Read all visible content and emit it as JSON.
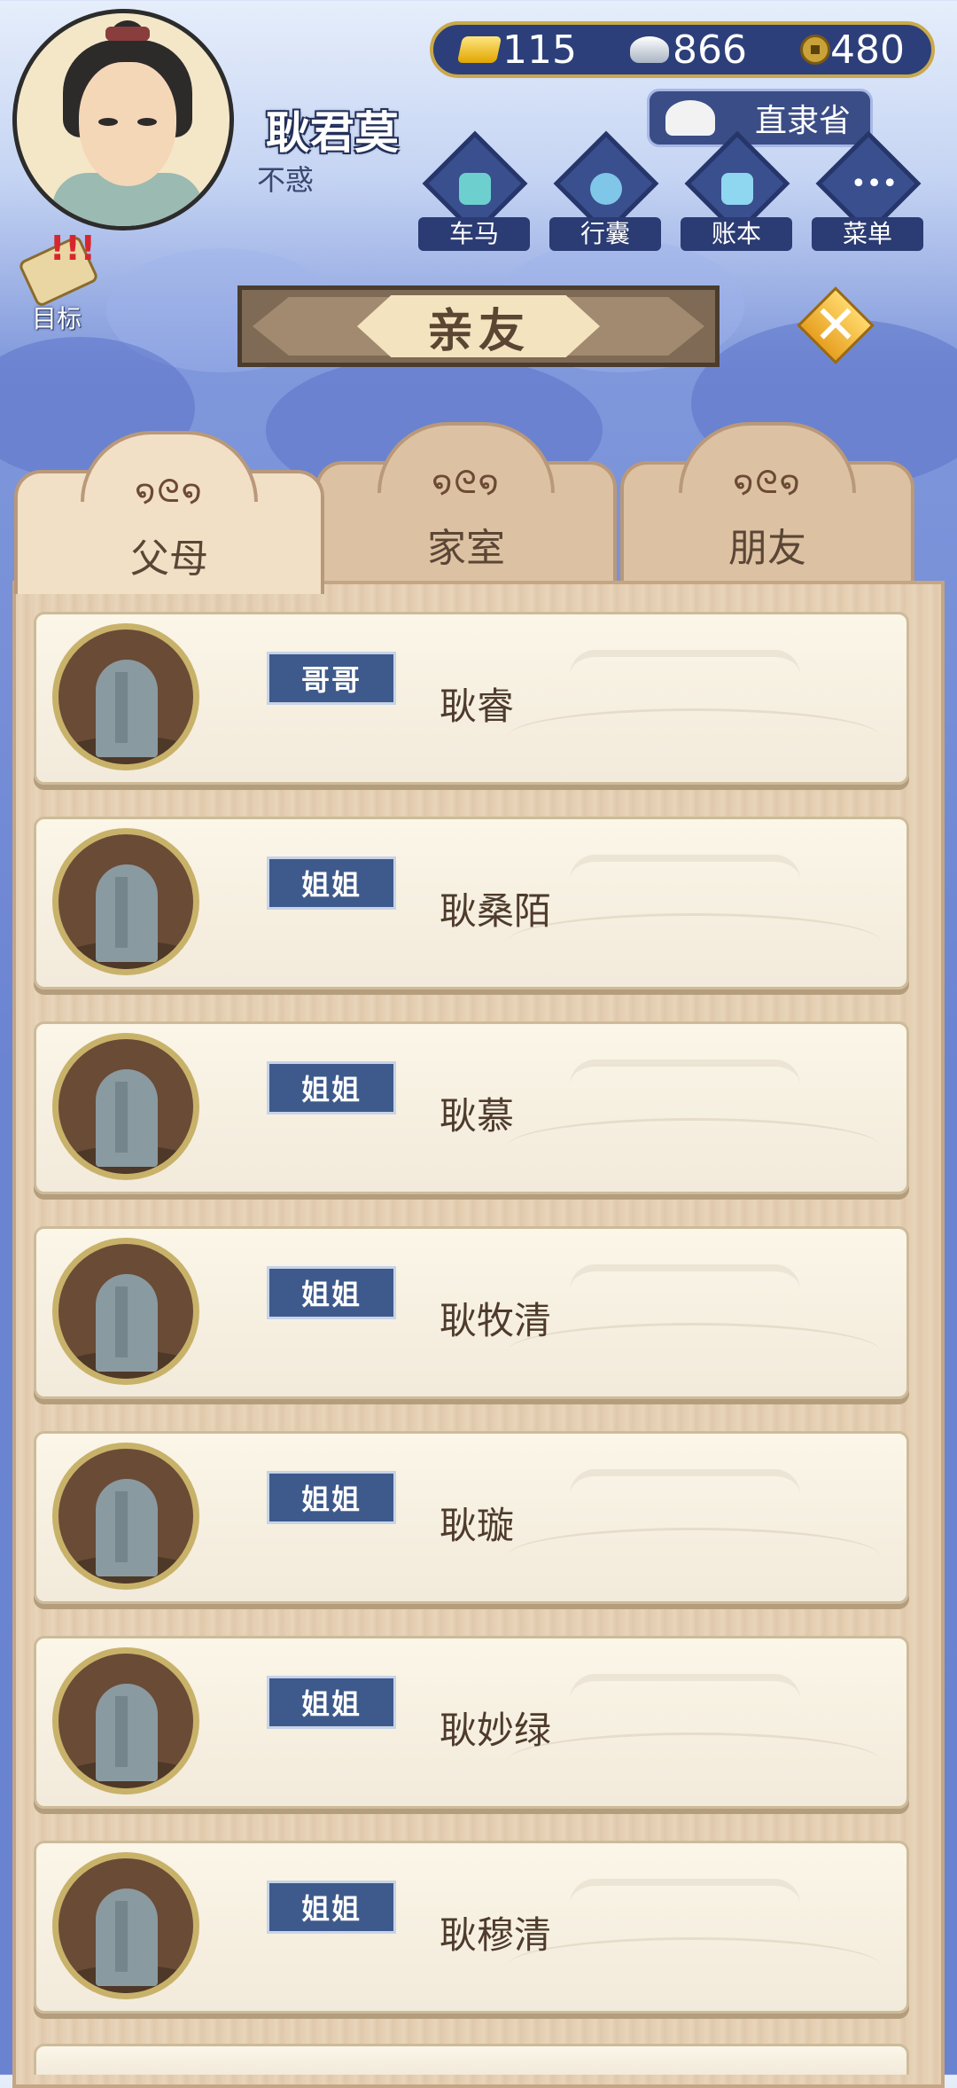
{
  "player": {
    "name": "耿君莫",
    "age_title": "不惑"
  },
  "currency": {
    "gold": "115",
    "silver": "866",
    "coins": "480"
  },
  "location": {
    "province": "直隶省"
  },
  "nav": [
    {
      "label": "车马",
      "icon": "carriage-icon"
    },
    {
      "label": "行囊",
      "icon": "bag-icon"
    },
    {
      "label": "账本",
      "icon": "ledger-icon"
    },
    {
      "label": "菜单",
      "icon": "menu-dots-icon"
    }
  ],
  "goal": {
    "label": "目标"
  },
  "page": {
    "title": "亲友"
  },
  "tabs": [
    {
      "label": "父母",
      "active": true
    },
    {
      "label": "家室",
      "active": false
    },
    {
      "label": "朋友",
      "active": false
    }
  ],
  "members": [
    {
      "relation": "哥哥",
      "name": "耿睿"
    },
    {
      "relation": "姐姐",
      "name": "耿桑陌"
    },
    {
      "relation": "姐姐",
      "name": "耿慕"
    },
    {
      "relation": "姐姐",
      "name": "耿牧清"
    },
    {
      "relation": "姐姐",
      "name": "耿璇"
    },
    {
      "relation": "姐姐",
      "name": "耿妙绿"
    },
    {
      "relation": "姐姐",
      "name": "耿穆清"
    }
  ],
  "colors": {
    "accent_gold": "#c9a94b",
    "tag_blue": "#3e5a8c",
    "wood": "#e4cfb3"
  }
}
